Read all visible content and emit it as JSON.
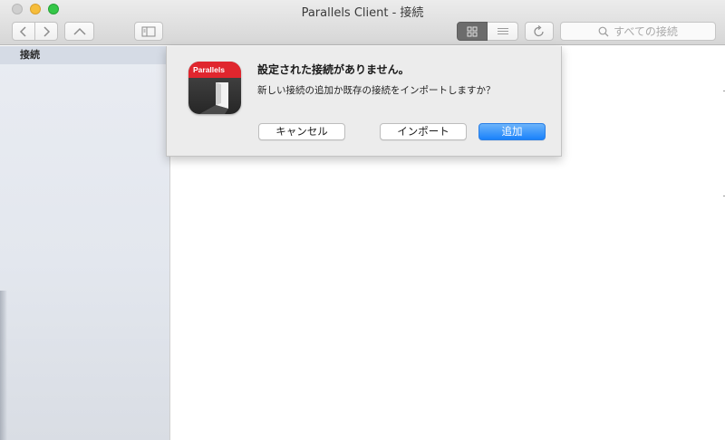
{
  "window": {
    "title": "Parallels Client - 接続"
  },
  "toolbar": {
    "back_icon": "chevron-left-icon",
    "forward_icon": "chevron-right-icon",
    "up_icon": "chevron-up-icon",
    "sidebar_icon": "sidebar-toggle-icon",
    "grid_view_icon": "grid-view-icon",
    "list_view_icon": "list-view-icon",
    "refresh_icon": "refresh-icon",
    "search_placeholder": "すべての接続"
  },
  "sidebar": {
    "items": [
      {
        "label": "接続"
      }
    ]
  },
  "dialog": {
    "app_icon_label": "Parallels",
    "title": "設定された接続がありません。",
    "message": "新しい接続の追加か既存の接続をインポートしますか？",
    "buttons": {
      "cancel": "キャンセル",
      "import": "インポート",
      "add": "追加"
    }
  },
  "colors": {
    "accent": "#1a82fb",
    "brand": "#e0262e"
  }
}
